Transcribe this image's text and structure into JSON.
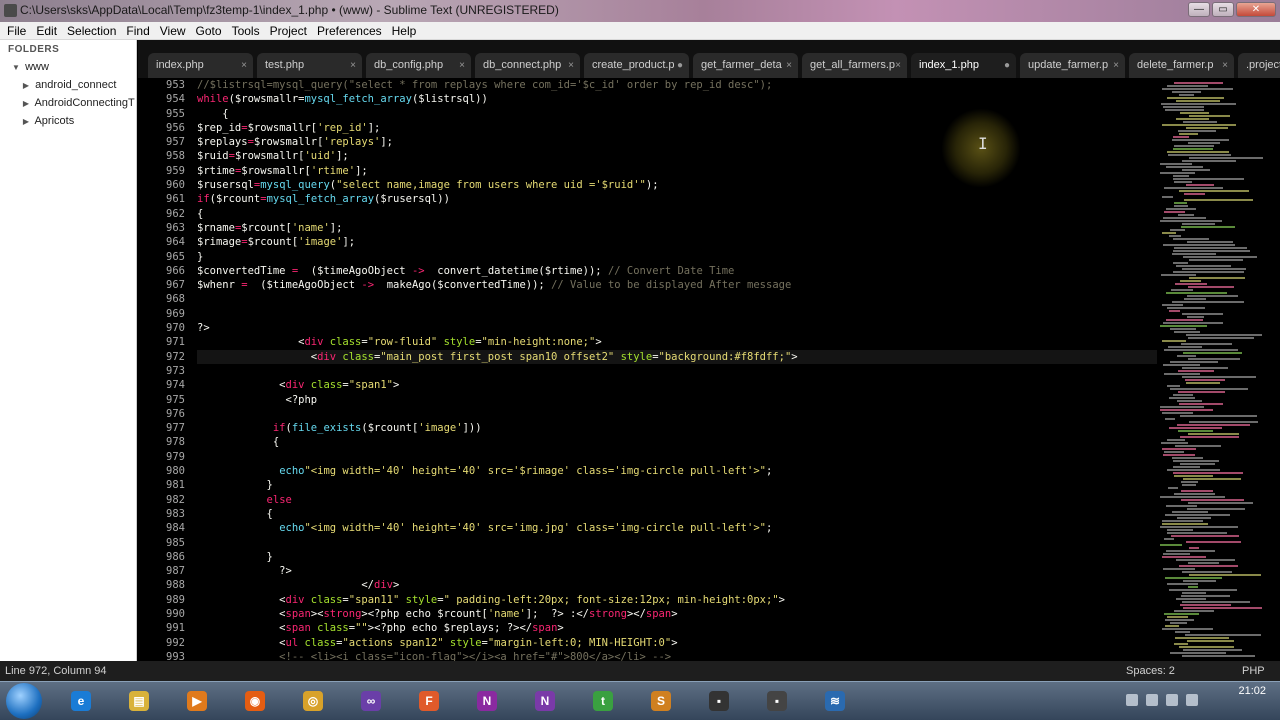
{
  "window": {
    "title": "C:\\Users\\sks\\AppData\\Local\\Temp\\fz3temp-1\\index_1.php • (www) - Sublime Text (UNREGISTERED)",
    "min": "—",
    "max": "▭",
    "close": "✕"
  },
  "menu": [
    "File",
    "Edit",
    "Selection",
    "Find",
    "View",
    "Goto",
    "Tools",
    "Project",
    "Preferences",
    "Help"
  ],
  "sidebar": {
    "header": "FOLDERS",
    "root": "www",
    "items": [
      "android_connect",
      "AndroidConnectingT",
      "Apricots"
    ]
  },
  "tabs": [
    {
      "label": "index.php",
      "mark": "×"
    },
    {
      "label": "test.php",
      "mark": "×"
    },
    {
      "label": "db_config.php",
      "mark": "×"
    },
    {
      "label": "db_connect.php",
      "mark": "×"
    },
    {
      "label": "create_product.p",
      "mark": "●"
    },
    {
      "label": "get_farmer_deta",
      "mark": "×"
    },
    {
      "label": "get_all_farmers.p",
      "mark": "×"
    },
    {
      "label": "index_1.php",
      "mark": "●",
      "active": true
    },
    {
      "label": "update_farmer.p",
      "mark": "×"
    },
    {
      "label": "delete_farmer.p",
      "mark": "×"
    },
    {
      "label": ".project",
      "mark": "×"
    }
  ],
  "editor": {
    "lines": [
      {
        "n": "953",
        "t": [
          [
            "c-comment",
            "//$listrsql=mysql_query(\"select * from replays where com_id='$c_id' order by rep_id desc\");"
          ]
        ]
      },
      {
        "n": "954",
        "t": [
          [
            "c-kw",
            "while"
          ],
          [
            "",
            "($rowsmallr="
          ],
          [
            "c-fn",
            "mysql_fetch_array"
          ],
          [
            "",
            "($listrsql))"
          ]
        ]
      },
      {
        "n": "955",
        "t": [
          [
            "",
            "    {"
          ]
        ]
      },
      {
        "n": "956",
        "t": [
          [
            "",
            "$rep_id"
          ],
          [
            "c-kw",
            "="
          ],
          [
            "",
            "$rowsmallr["
          ],
          [
            "c-str",
            "'rep_id'"
          ],
          [
            "",
            "];"
          ]
        ]
      },
      {
        "n": "957",
        "t": [
          [
            "",
            "$replays"
          ],
          [
            "c-kw",
            "="
          ],
          [
            "",
            "$rowsmallr["
          ],
          [
            "c-str",
            "'replays'"
          ],
          [
            "",
            "];"
          ]
        ]
      },
      {
        "n": "958",
        "t": [
          [
            "",
            "$ruid"
          ],
          [
            "c-kw",
            "="
          ],
          [
            "",
            "$rowsmallr["
          ],
          [
            "c-str",
            "'uid'"
          ],
          [
            "",
            "];"
          ]
        ]
      },
      {
        "n": "959",
        "t": [
          [
            "",
            "$rtime"
          ],
          [
            "c-kw",
            "="
          ],
          [
            "",
            "$rowsmallr["
          ],
          [
            "c-str",
            "'rtime'"
          ],
          [
            "",
            "];"
          ]
        ]
      },
      {
        "n": "960",
        "t": [
          [
            "",
            "$rusersql"
          ],
          [
            "c-kw",
            "="
          ],
          [
            "c-fn",
            "mysql_query"
          ],
          [
            "",
            "("
          ],
          [
            "c-str",
            "\"select name,image from users where uid ='$ruid'\""
          ],
          [
            "",
            ");"
          ]
        ]
      },
      {
        "n": "961",
        "t": [
          [
            "c-kw",
            "if"
          ],
          [
            "",
            "($rcount"
          ],
          [
            "c-kw",
            "="
          ],
          [
            "c-fn",
            "mysql_fetch_array"
          ],
          [
            "",
            "($rusersql))"
          ]
        ]
      },
      {
        "n": "962",
        "t": [
          [
            "",
            "{"
          ]
        ]
      },
      {
        "n": "963",
        "t": [
          [
            "",
            "$rname"
          ],
          [
            "c-kw",
            "="
          ],
          [
            "",
            "$rcount["
          ],
          [
            "c-str",
            "'name'"
          ],
          [
            "",
            "];"
          ]
        ]
      },
      {
        "n": "964",
        "t": [
          [
            "",
            "$rimage"
          ],
          [
            "c-kw",
            "="
          ],
          [
            "",
            "$rcount["
          ],
          [
            "c-str",
            "'image'"
          ],
          [
            "",
            "];"
          ]
        ]
      },
      {
        "n": "965",
        "t": [
          [
            "",
            "}"
          ]
        ]
      },
      {
        "n": "966",
        "t": [
          [
            "",
            "$convertedTime "
          ],
          [
            "c-kw",
            "="
          ],
          [
            "",
            "  ($timeAgoObject "
          ],
          [
            "c-kw",
            "->"
          ],
          [
            "",
            "  convert_datetime($rtime)); "
          ],
          [
            "c-comment",
            "// Convert Date Time"
          ]
        ]
      },
      {
        "n": "967",
        "t": [
          [
            "",
            "$whenr "
          ],
          [
            "c-kw",
            "="
          ],
          [
            "",
            "  ($timeAgoObject "
          ],
          [
            "c-kw",
            "->"
          ],
          [
            "",
            "  makeAgo($convertedTime)); "
          ],
          [
            "c-comment",
            "// Value to be displayed After message"
          ]
        ]
      },
      {
        "n": "968",
        "t": [
          [
            "",
            ""
          ]
        ]
      },
      {
        "n": "969",
        "t": [
          [
            "",
            ""
          ]
        ]
      },
      {
        "n": "970",
        "t": [
          [
            "",
            "?>"
          ]
        ]
      },
      {
        "n": "971",
        "t": [
          [
            "",
            "                <"
          ],
          [
            "c-kw",
            "div"
          ],
          [
            "c-attr",
            " class"
          ],
          [
            "",
            "="
          ],
          [
            "c-str",
            "\"row-fluid\""
          ],
          [
            "c-attr",
            " style"
          ],
          [
            "",
            "="
          ],
          [
            "c-str",
            "\"min-height:none;\""
          ],
          [
            "",
            ">"
          ]
        ]
      },
      {
        "n": "972",
        "t": [
          [
            "",
            "                  <"
          ],
          [
            "c-kw",
            "div"
          ],
          [
            "c-attr",
            " class"
          ],
          [
            "",
            "="
          ],
          [
            "c-str",
            "\"main_post first_post span10 offset2\""
          ],
          [
            "c-attr",
            " style"
          ],
          [
            "",
            "="
          ],
          [
            "c-str",
            "\"background:#f8fdff;\""
          ],
          [
            "",
            ">"
          ]
        ],
        "cur": true
      },
      {
        "n": "973",
        "t": [
          [
            "",
            ""
          ]
        ]
      },
      {
        "n": "974",
        "t": [
          [
            "",
            "             <"
          ],
          [
            "c-kw",
            "div"
          ],
          [
            "c-attr",
            " class"
          ],
          [
            "",
            "="
          ],
          [
            "c-str",
            "\"span1\""
          ],
          [
            "",
            ">"
          ]
        ]
      },
      {
        "n": "975",
        "t": [
          [
            "",
            "              <?php"
          ]
        ]
      },
      {
        "n": "976",
        "t": [
          [
            "",
            ""
          ]
        ]
      },
      {
        "n": "977",
        "t": [
          [
            "",
            "            "
          ],
          [
            "c-kw",
            "if"
          ],
          [
            "",
            "",
            " "
          ],
          [
            "",
            "("
          ],
          [
            "c-fn",
            "file_exists"
          ],
          [
            "",
            "($rcount["
          ],
          [
            "c-str",
            "'image'"
          ],
          [
            "",
            "]))"
          ]
        ]
      },
      {
        "n": "978",
        "t": [
          [
            "",
            "            {"
          ]
        ]
      },
      {
        "n": "979",
        "t": [
          [
            "",
            ""
          ]
        ]
      },
      {
        "n": "980",
        "t": [
          [
            "",
            "             "
          ],
          [
            "c-fn",
            "echo"
          ],
          [
            "c-str",
            "\"<img width='40' height='40' src='$rimage' class='img-circle pull-left'>\""
          ],
          [
            "",
            ";"
          ]
        ]
      },
      {
        "n": "981",
        "t": [
          [
            "",
            "           }"
          ]
        ]
      },
      {
        "n": "982",
        "t": [
          [
            "",
            "           "
          ],
          [
            "c-kw",
            "else"
          ]
        ]
      },
      {
        "n": "983",
        "t": [
          [
            "",
            "           {"
          ]
        ]
      },
      {
        "n": "984",
        "t": [
          [
            "",
            "             "
          ],
          [
            "c-fn",
            "echo"
          ],
          [
            "c-str",
            "\"<img width='40' height='40' src='img.jpg' class='img-circle pull-left'>\""
          ],
          [
            "",
            ";"
          ]
        ]
      },
      {
        "n": "985",
        "t": [
          [
            "",
            ""
          ]
        ]
      },
      {
        "n": "986",
        "t": [
          [
            "",
            "           }"
          ]
        ]
      },
      {
        "n": "987",
        "t": [
          [
            "",
            "             ?>"
          ]
        ]
      },
      {
        "n": "988",
        "t": [
          [
            "",
            "                          </"
          ],
          [
            "c-kw",
            "div"
          ],
          [
            "",
            ">"
          ]
        ]
      },
      {
        "n": "989",
        "t": [
          [
            "",
            "             <"
          ],
          [
            "c-kw",
            "div"
          ],
          [
            "c-attr",
            " class"
          ],
          [
            "",
            "="
          ],
          [
            "c-str",
            "\"span11\""
          ],
          [
            "c-attr",
            " style"
          ],
          [
            "",
            "="
          ],
          [
            "c-str",
            "\" padding-left:20px; font-size:12px; min-height:0px;\""
          ],
          [
            "",
            ">"
          ]
        ]
      },
      {
        "n": "990",
        "t": [
          [
            "",
            "             <"
          ],
          [
            "c-kw",
            "span"
          ],
          [
            "",
            "><"
          ],
          [
            "c-kw",
            "strong"
          ],
          [
            "",
            ">"
          ],
          [
            "",
            "<?php echo $rcount["
          ],
          [
            "c-str",
            "'name'"
          ],
          [
            "",
            "];  ?> :</"
          ],
          [
            "c-kw",
            "strong"
          ],
          [
            "",
            "></"
          ],
          [
            "c-kw",
            "span"
          ],
          [
            "",
            ">"
          ]
        ]
      },
      {
        "n": "991",
        "t": [
          [
            "",
            "             <"
          ],
          [
            "c-kw",
            "span"
          ],
          [
            "c-attr",
            " class"
          ],
          [
            "",
            "="
          ],
          [
            "c-str",
            "\"\""
          ],
          [
            "",
            ">"
          ],
          [
            "",
            "<?php echo $replays; ?></"
          ],
          [
            "c-kw",
            "span"
          ],
          [
            "",
            ">"
          ]
        ]
      },
      {
        "n": "992",
        "t": [
          [
            "",
            "             <"
          ],
          [
            "c-kw",
            "ul"
          ],
          [
            "c-attr",
            " class"
          ],
          [
            "",
            "="
          ],
          [
            "c-str",
            "\"actions span12\""
          ],
          [
            "c-attr",
            " style"
          ],
          [
            "",
            "="
          ],
          [
            "c-str",
            "\"margin-left:0; MIN-HEIGHT:0\""
          ],
          [
            "",
            ">"
          ]
        ]
      },
      {
        "n": "993",
        "t": [
          [
            "c-comment",
            "             <!-- <li><i class=\"icon-flag\"></i><a href=\"#\">800</a></li> -->"
          ]
        ]
      }
    ]
  },
  "status": {
    "position": "Line 972, Column 94",
    "spaces": "Spaces: 2",
    "syntax": "PHP"
  },
  "taskbar": {
    "time": "21:02",
    "apps": [
      "ie-icon",
      "explorer-icon",
      "media-player-icon",
      "firefox-icon",
      "chrome-icon",
      "visual-studio-icon",
      "filezilla-icon",
      "onenote-icon",
      "onenote2-icon",
      "gtalk-icon",
      "sublime-icon",
      "cmd-icon",
      "cmd2-icon",
      "wifi-icon"
    ]
  }
}
